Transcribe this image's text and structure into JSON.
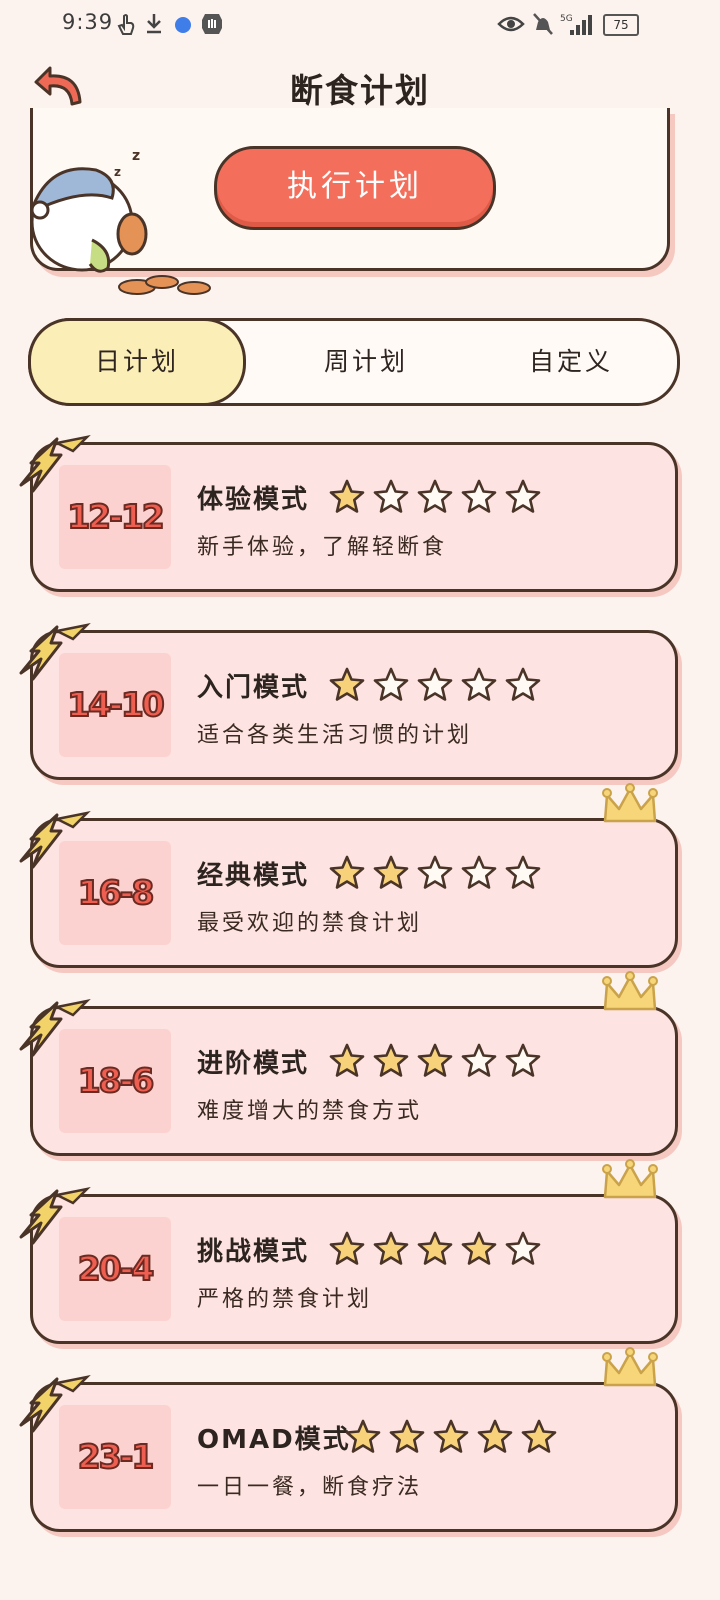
{
  "status_bar": {
    "time": "9:39",
    "battery": "75",
    "network": "5G"
  },
  "header": {
    "title": "断食计划"
  },
  "top_card": {
    "execute_label": "执行计划"
  },
  "tabs": [
    {
      "label": "日计划",
      "active": true
    },
    {
      "label": "周计划",
      "active": false
    },
    {
      "label": "自定义",
      "active": false
    }
  ],
  "plans": [
    {
      "ratio": "12-12",
      "title": "体验模式",
      "desc": "新手体验，了解轻断食",
      "stars": 1,
      "crown": false
    },
    {
      "ratio": "14-10",
      "title": "入门模式",
      "desc": "适合各类生活习惯的计划",
      "stars": 1,
      "crown": false
    },
    {
      "ratio": "16-8",
      "title": "经典模式",
      "desc": "最受欢迎的禁食计划",
      "stars": 2,
      "crown": true
    },
    {
      "ratio": "18-6",
      "title": "进阶模式",
      "desc": "难度增大的禁食方式",
      "stars": 3,
      "crown": true
    },
    {
      "ratio": "20-4",
      "title": "挑战模式",
      "desc": "严格的禁食计划",
      "stars": 4,
      "crown": true
    },
    {
      "ratio": "23-1",
      "title": "OMAD模式",
      "desc": "一日一餐，断食疗法",
      "stars": 5,
      "crown": true
    }
  ],
  "colors": {
    "accent": "#f36f5c",
    "card_bg": "#fde3e1",
    "star_fill": "#f7d27a",
    "tab_active": "#fbeeb7"
  }
}
